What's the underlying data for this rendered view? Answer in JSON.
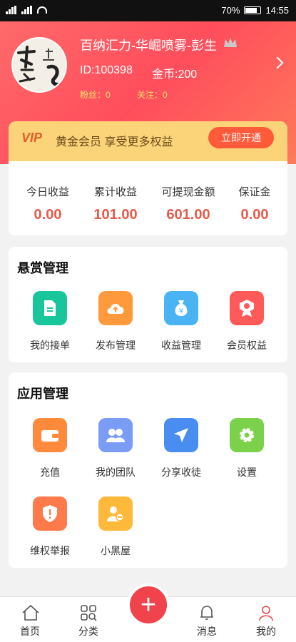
{
  "status_bar": {
    "battery": "70%",
    "time": "14:55"
  },
  "profile": {
    "name": "百纳汇力-华崛喷雾-彭生",
    "id_label": "ID:100398",
    "coins_label": "金币:200",
    "fans_label": "粉丝：",
    "fans_count": "0",
    "follow_label": "关注：",
    "follow_count": "0"
  },
  "vip": {
    "tag": "VIP",
    "text": "黄金会员 享受更多权益",
    "button": "立即开通"
  },
  "stats": [
    {
      "label": "今日收益",
      "value": "0.00"
    },
    {
      "label": "累计收益",
      "value": "101.00"
    },
    {
      "label": "可提现金额",
      "value": "601.00"
    },
    {
      "label": "保证金",
      "value": "0.00"
    }
  ],
  "reward_section": {
    "title": "悬赏管理",
    "items": [
      {
        "label": "我的接单",
        "icon": "document-icon",
        "color": "#19c59a"
      },
      {
        "label": "发布管理",
        "icon": "cloud-upload-icon",
        "color": "#ff9a3c"
      },
      {
        "label": "收益管理",
        "icon": "money-bag-icon",
        "color": "#4ab3f4"
      },
      {
        "label": "会员权益",
        "icon": "badge-icon",
        "color": "#ff5a5a"
      }
    ]
  },
  "app_section": {
    "title": "应用管理",
    "items": [
      {
        "label": "充值",
        "icon": "wallet-icon",
        "color": "#ff8a3c"
      },
      {
        "label": "我的团队",
        "icon": "team-icon",
        "color": "#7b9cf5"
      },
      {
        "label": "分享收徒",
        "icon": "paper-plane-icon",
        "color": "#4a8df0"
      },
      {
        "label": "设置",
        "icon": "gear-icon",
        "color": "#7bd24a"
      },
      {
        "label": "维权举报",
        "icon": "shield-icon",
        "color": "#ff7a4a"
      },
      {
        "label": "小黑屋",
        "icon": "user-block-icon",
        "color": "#ffb93a"
      }
    ]
  },
  "tabbar": [
    {
      "label": "首页",
      "icon": "home-icon"
    },
    {
      "label": "分类",
      "icon": "grid-search-icon"
    },
    {
      "label": "",
      "icon": "plus-icon"
    },
    {
      "label": "消息",
      "icon": "bell-icon"
    },
    {
      "label": "我的",
      "icon": "person-icon"
    }
  ]
}
